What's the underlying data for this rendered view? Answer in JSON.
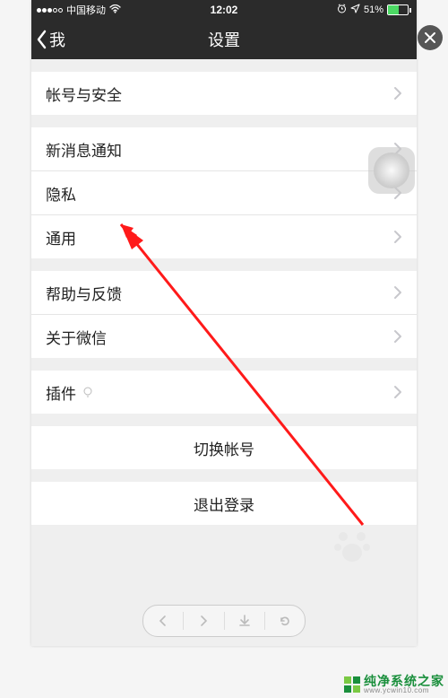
{
  "statusbar": {
    "carrier": "中国移动",
    "time": "12:02",
    "battery_pct": "51%"
  },
  "nav": {
    "back_label": "我",
    "title": "设置"
  },
  "groups": [
    {
      "items": [
        {
          "label": "帐号与安全",
          "name": "cell-account-security"
        }
      ]
    },
    {
      "items": [
        {
          "label": "新消息通知",
          "name": "cell-notifications"
        },
        {
          "label": "隐私",
          "name": "cell-privacy"
        },
        {
          "label": "通用",
          "name": "cell-general"
        }
      ]
    },
    {
      "items": [
        {
          "label": "帮助与反馈",
          "name": "cell-help-feedback"
        },
        {
          "label": "关于微信",
          "name": "cell-about-wechat"
        }
      ]
    },
    {
      "items": [
        {
          "label": "插件",
          "name": "cell-plugins",
          "bulb": true
        }
      ]
    }
  ],
  "actions": {
    "switch_account": "切换帐号",
    "logout": "退出登录"
  },
  "watermark": {
    "brand": "纯净系统之家",
    "url": "www.ycwin10.com"
  }
}
